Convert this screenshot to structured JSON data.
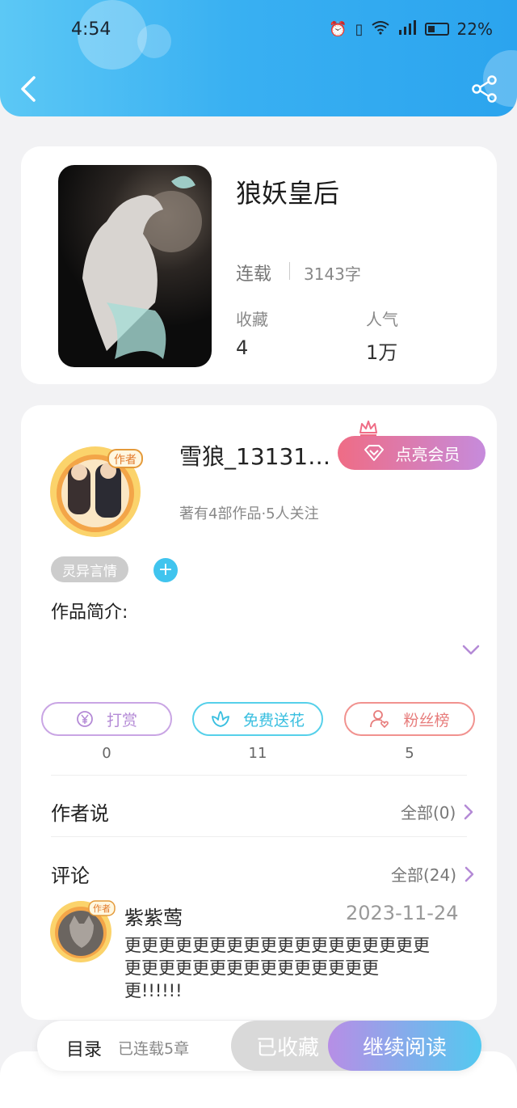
{
  "status_bar": {
    "time": "4:54",
    "battery": "22%",
    "network": "4G"
  },
  "header": {
    "back_icon": "chevron-left-icon",
    "share_icon": "share-icon"
  },
  "book": {
    "title": "狼妖皇后",
    "status": "连载",
    "word_count": "3143字",
    "favorites_label": "收藏",
    "favorites_value": "4",
    "popularity_label": "人气",
    "popularity_value": "1万"
  },
  "author": {
    "name": "雪狼_131312…",
    "meta": "著有4部作品·5人关注",
    "vip_button": "点亮会员",
    "tag": "灵异言情",
    "tag_add": "+",
    "intro_label": "作品简介:"
  },
  "actions": [
    {
      "label": "打赏",
      "count": "0",
      "icon": "yen-icon"
    },
    {
      "label": "免费送花",
      "count": "11",
      "icon": "flower-icon"
    },
    {
      "label": "粉丝榜",
      "count": "5",
      "icon": "fans-icon"
    }
  ],
  "author_says": {
    "title": "作者说",
    "link": "全部(0)"
  },
  "comments": {
    "title": "评论",
    "link": "全部(24)",
    "items": [
      {
        "user": "紫紫莺",
        "date": "2023-11-24",
        "text": "更更更更更更更更更更更更更更更更更更更更更更更更更更更更更更更更更更!!!!!!"
      }
    ]
  },
  "bottom_bar": {
    "toc": "目录",
    "toc_sub": "已连载5章",
    "favorited": "已收藏",
    "continue": "继续阅读"
  },
  "colors": {
    "header_start": "#5cc8f5",
    "header_end": "#2ba4ee",
    "vip_start": "#ef6c85",
    "vip_end": "#c68bdc",
    "accent_blue": "#40c4ee"
  }
}
